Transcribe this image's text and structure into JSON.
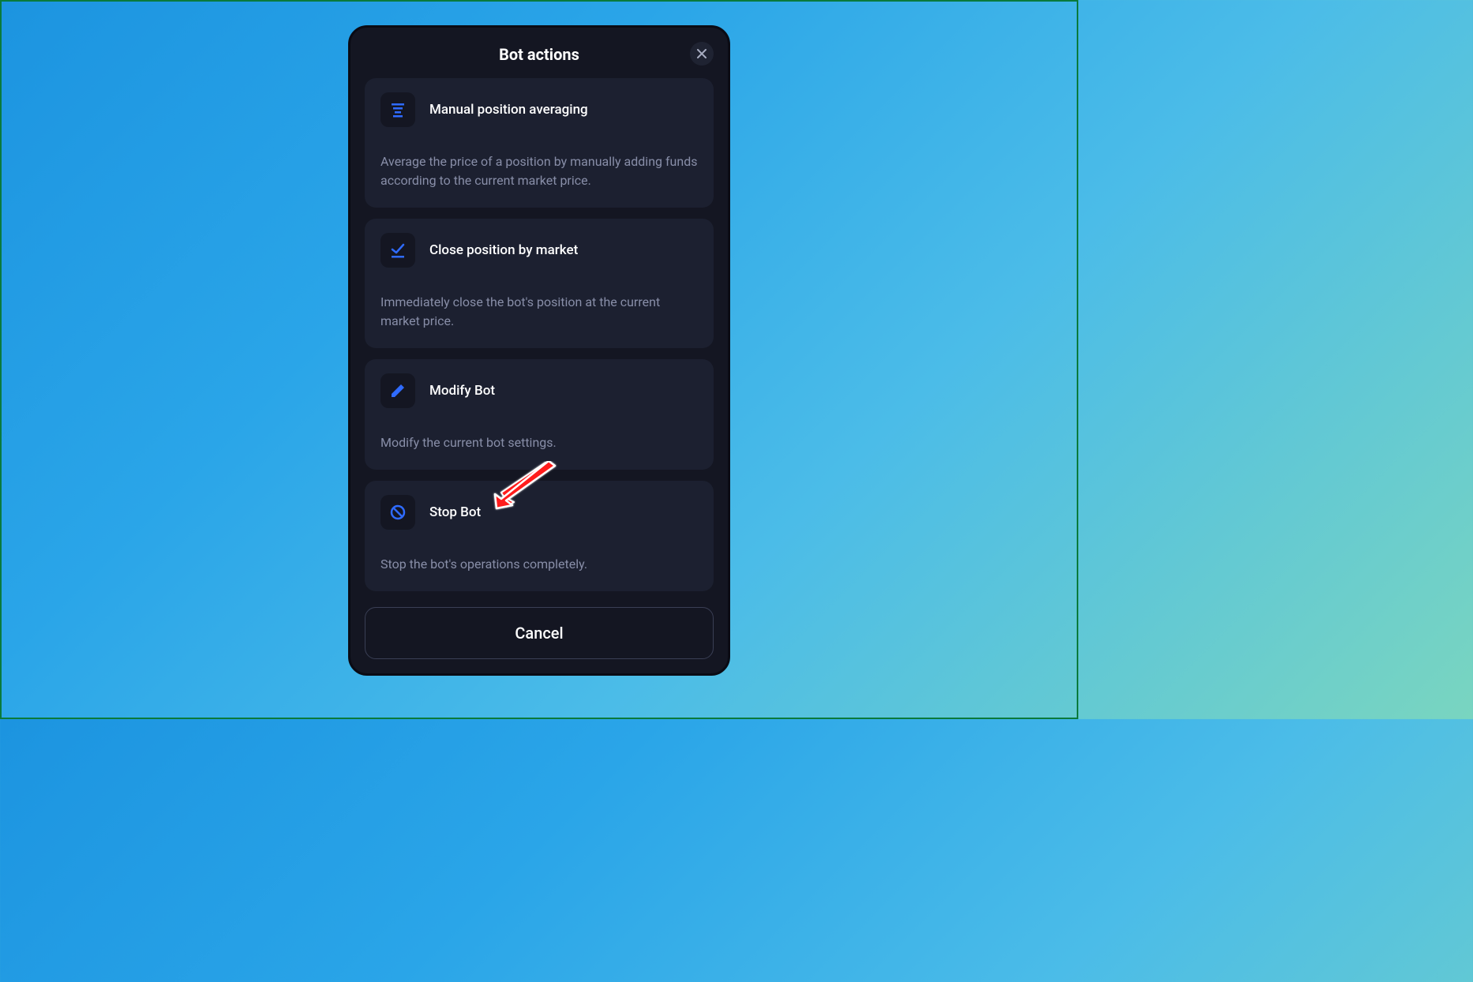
{
  "modal": {
    "title": "Bot actions",
    "cancel_label": "Cancel"
  },
  "actions": [
    {
      "title": "Manual position averaging",
      "description": "Average the price of a position by manually adding funds according to the current market price."
    },
    {
      "title": "Close position by market",
      "description": "Immediately close the bot's position at the current market price."
    },
    {
      "title": "Modify Bot",
      "description": "Modify the current bot settings."
    },
    {
      "title": "Stop Bot",
      "description": "Stop the bot's operations completely."
    }
  ]
}
